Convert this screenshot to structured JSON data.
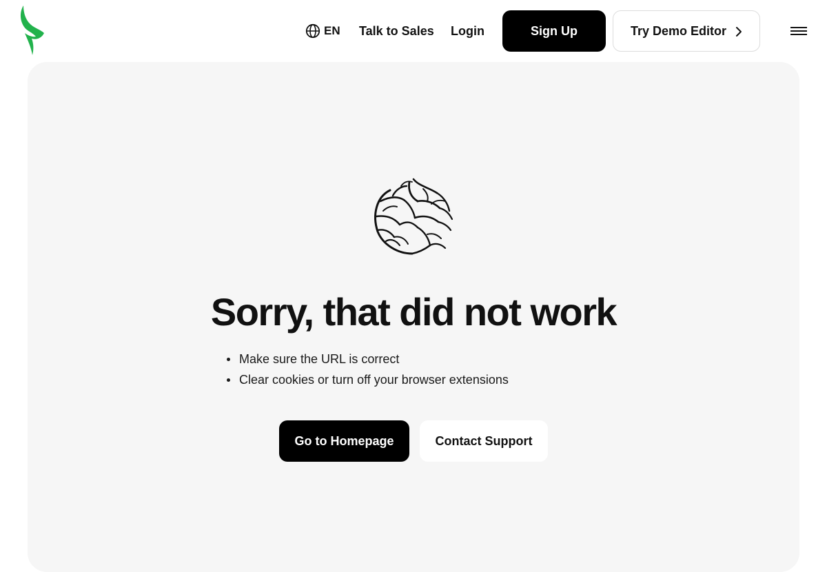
{
  "header": {
    "logo": {
      "icon": "lightning-leaf-logo",
      "color": "#22b24c"
    },
    "language": {
      "icon": "globe-icon",
      "label": "EN"
    },
    "nav": {
      "talk_to_sales": "Talk to Sales",
      "login": "Login"
    },
    "signup_label": "Sign Up",
    "demo_label": "Try Demo Editor",
    "demo_icon": "chevron-right-icon",
    "menu_icon": "hamburger-menu-icon"
  },
  "error": {
    "illustration": "tangled-branches-illustration",
    "title": "Sorry, that did not work",
    "tips": [
      "Make sure the URL is correct",
      "Clear cookies or turn off your browser extensions"
    ],
    "primary_label": "Go to Homepage",
    "secondary_label": "Contact Support"
  },
  "colors": {
    "accent": "#22b24c",
    "primary_button": "#000000",
    "panel_background": "#f6f6f6"
  }
}
